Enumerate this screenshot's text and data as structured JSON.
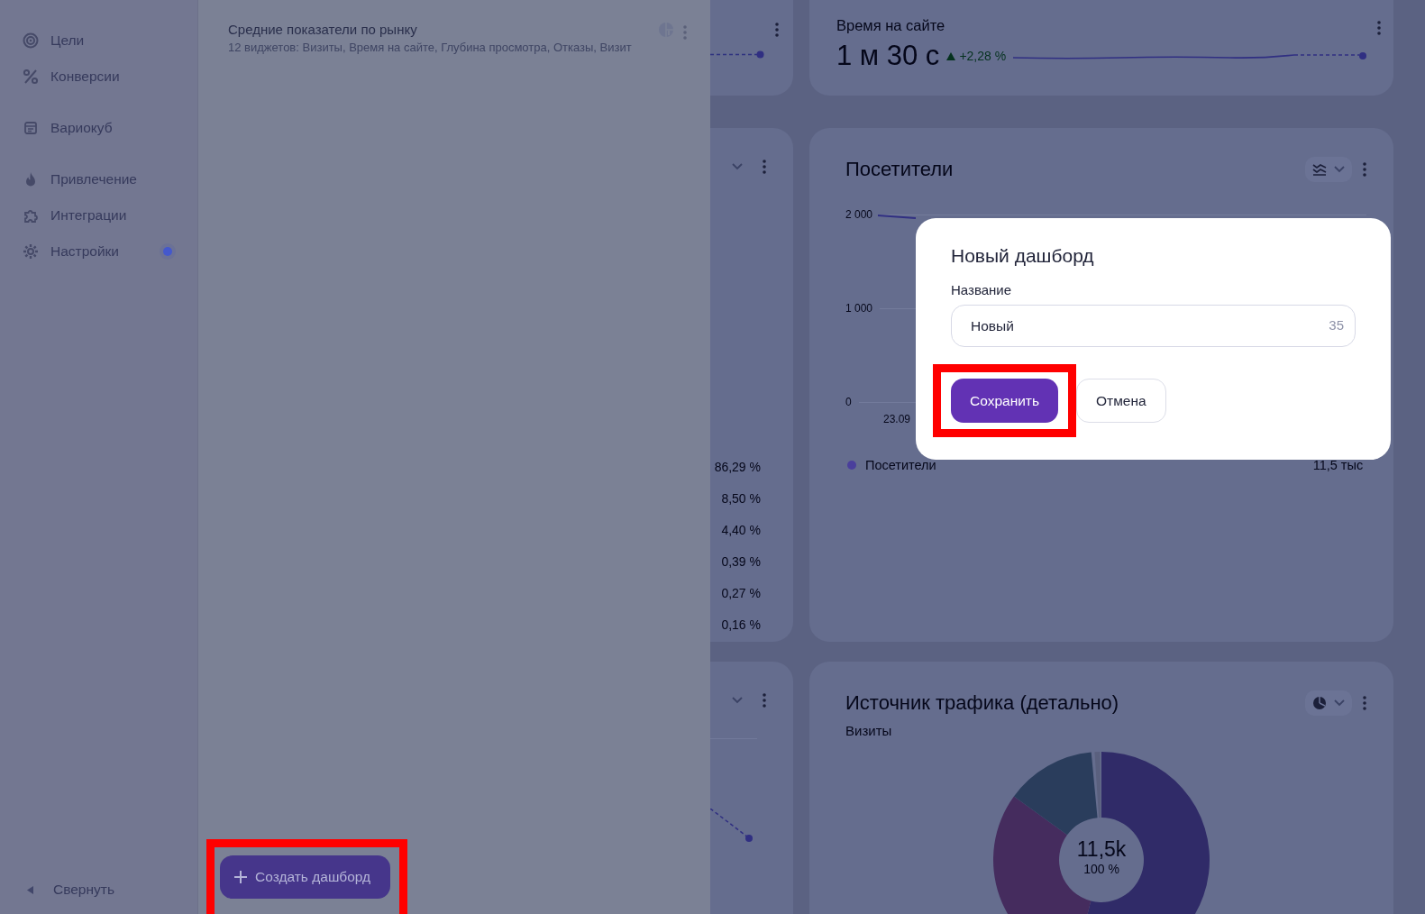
{
  "sidebar": {
    "groups": [
      [
        {
          "label": "Цели",
          "badge": false
        },
        {
          "label": "Конверсии",
          "badge": false
        }
      ],
      [
        {
          "label": "Вариокуб",
          "badge": false
        }
      ],
      [
        {
          "label": "Привлечение",
          "badge": false
        },
        {
          "label": "Интеграции",
          "badge": false
        },
        {
          "label": "Настройки",
          "badge": true
        }
      ]
    ],
    "collapse": "Свернуть"
  },
  "drawer": {
    "dashboards": [
      {
        "title": "Средние показатели по рынку",
        "subtitle": "12 виджетов: Визиты, Время на сайте, Глубина просмотра, Отказы, Визит"
      }
    ],
    "create_button": {
      "label": "Создать дашборд",
      "highlighted": true
    }
  },
  "dashboard": {
    "left_column": {
      "percentages": [
        "86,29 %",
        "8,50 %",
        "4,40 %",
        "0,39 %",
        "0,27 %",
        "0,16 %"
      ]
    },
    "time_card": {
      "title": "Время на сайте",
      "value": "1 м 30 с",
      "delta": "+2,28 %"
    },
    "visitors_card": {
      "title": "Посетители",
      "y_labels": [
        "2 000",
        "1 000",
        "0"
      ],
      "x_labels": [
        "23.09"
      ],
      "legend": [
        {
          "label": "Посетители",
          "value": "11,5 тыс",
          "color": "#4a3f9c"
        }
      ]
    },
    "traffic_card": {
      "title": "Источник трафика (детально)",
      "subtitle": "Визиты",
      "center_value": "11,5k",
      "center_share": "100 %"
    }
  },
  "modal": {
    "title": "Новый дашборд",
    "label": "Название",
    "value": "Новый",
    "counter": "35",
    "buttons": [
      {
        "label": "Сохранить",
        "kind": "primary",
        "highlighted": true
      },
      {
        "label": "Отмена",
        "kind": "secondary",
        "highlighted": false
      }
    ]
  }
}
